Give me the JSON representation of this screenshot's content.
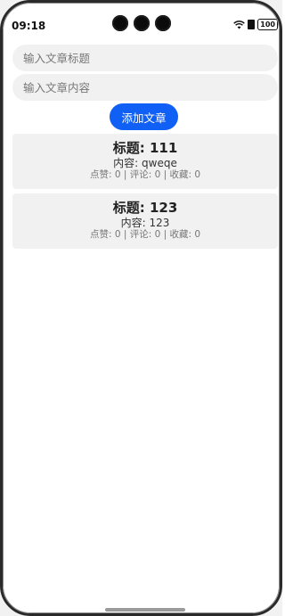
{
  "status_bar": {
    "time": "09:18",
    "battery": "100"
  },
  "form": {
    "title_placeholder": "输入文章标题",
    "content_placeholder": "输入文章内容",
    "add_button_label": "添加文章"
  },
  "articles": [
    {
      "title": "标题: 111",
      "content": "内容: qweqe",
      "stats": "点赞: 0 | 评论: 0 | 收藏: 0"
    },
    {
      "title": "标题: 123",
      "content": "内容: 123",
      "stats": "点赞: 0 | 评论: 0 | 收藏: 0"
    }
  ],
  "colors": {
    "accent": "#1160f5",
    "card_background": "#f1f1f1",
    "input_background": "#f1f1f1"
  },
  "icons": [
    "wifi-icon",
    "nfc-icon",
    "battery-icon",
    "camera-cutout"
  ]
}
